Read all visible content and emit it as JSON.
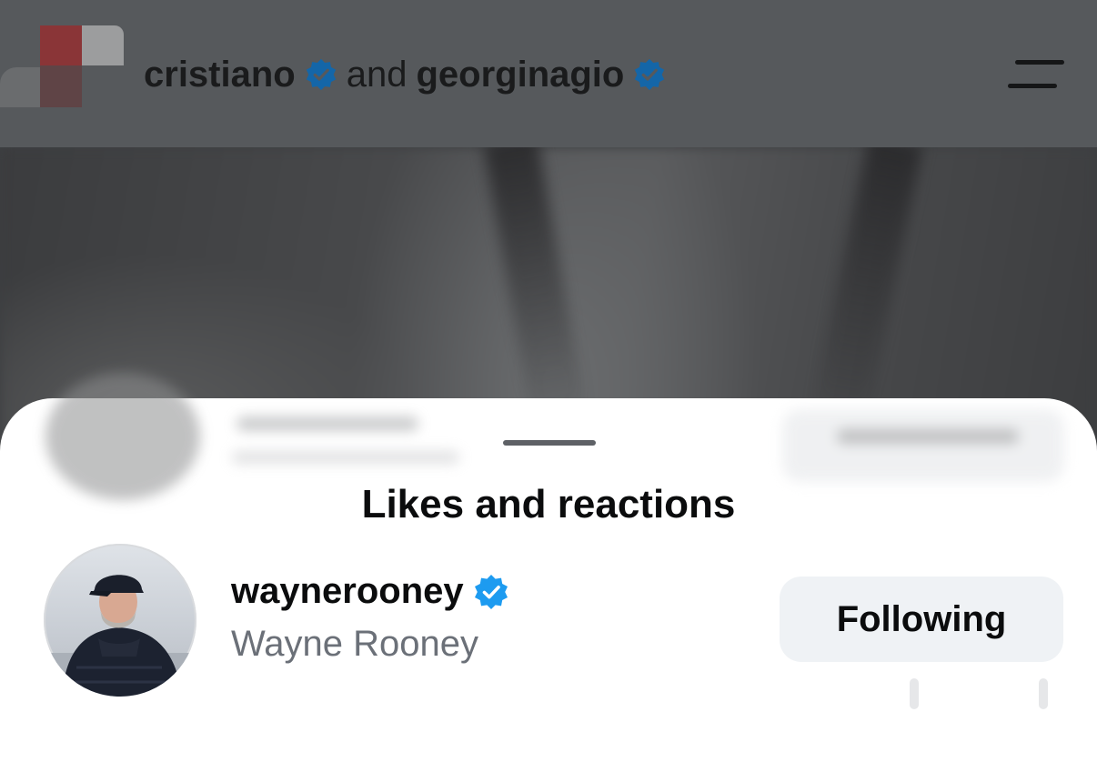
{
  "header": {
    "account1": "cristiano",
    "conjunction": "and",
    "account2": "georginagio",
    "menu_icon": "hamburger-menu-icon"
  },
  "sheet": {
    "title": "Likes and reactions"
  },
  "user": {
    "username": "waynerooney",
    "full_name": "Wayne Rooney",
    "verified_icon": "verified-badge-icon",
    "follow_button": "Following"
  },
  "colors": {
    "verified_blue": "#1d9bf0",
    "button_bg": "#eff2f5",
    "secondary_text": "#6b7078"
  }
}
